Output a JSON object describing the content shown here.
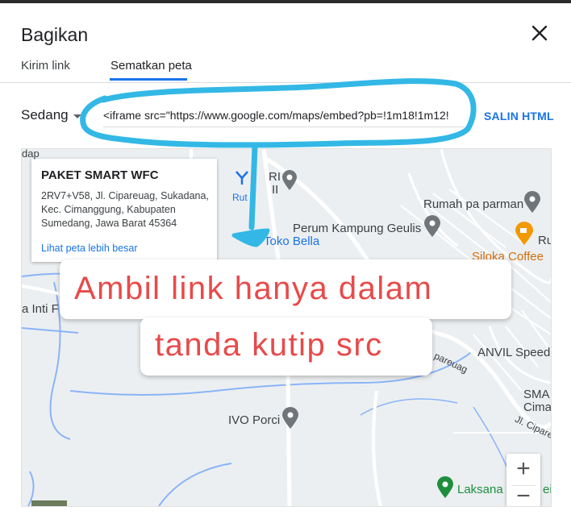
{
  "dialog": {
    "title": "Bagikan",
    "tabs": [
      {
        "label": "Kirim link",
        "active": false
      },
      {
        "label": "Sematkan peta",
        "active": true
      }
    ]
  },
  "embed": {
    "size_label": "Sedang",
    "code": "<iframe src=\"https://www.google.com/maps/embed?pb=!1m18!1m12!",
    "copy_label": "SALIN HTML"
  },
  "map": {
    "card": {
      "title": "PAKET SMART WFC",
      "address": "2RV7+V58, Jl. Cipareuag, Sukadana, Kec. Cimanggung, Kabupaten Sumedang, Jawa Barat 45364",
      "link": "Lihat peta lebih besar",
      "route": "Rut"
    },
    "labels": {
      "rumah": "Rumah pa parman",
      "perum": "Perum Kampung Geulis",
      "toko": "Toko Bella",
      "siloka": "Siloka Coffee",
      "anvil": "ANVIL Speed",
      "ivo": "IVO Porci",
      "laksana": "Laksana",
      "sma": "SMA",
      "cima": "Cima",
      "ri": "RI",
      "ii": "II",
      "ru": "Ru",
      "dap": "dap",
      "inti": "a Inti F",
      "jl_cipare1": "Jl. Cipare",
      "jl_cipare2": "pareuag",
      "kei": "ei"
    },
    "zoom_in": "+",
    "zoom_out": "−"
  },
  "annotation": {
    "line1": "Ambil link hanya dalam",
    "line2": "tanda kutip src"
  },
  "colors": {
    "accent": "#1a73e8",
    "scribble": "#33b8e6",
    "callout_text": "#e84a4a",
    "pin_gray": "#70757a",
    "pin_green": "#1e8e3e",
    "pin_orange": "#f29900"
  }
}
